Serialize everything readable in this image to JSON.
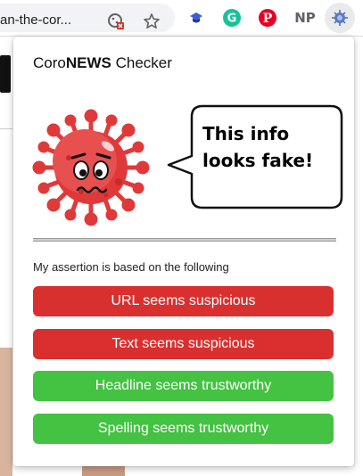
{
  "browser": {
    "url_fragment": "an-the-cor...",
    "extensions": [
      "pinwheel-extension-icon",
      "grammarly-icon",
      "pinterest-icon",
      "np-icon",
      "coronews-icon"
    ],
    "np_label": "NP"
  },
  "popup": {
    "title_prefix": "Coro",
    "title_bold": "NEWS",
    "title_suffix": " Checker",
    "verdict_line1": "This info",
    "verdict_line2": "looks fake!",
    "assertion_label": "My assertion is based on the following",
    "reasons": [
      {
        "label": "URL seems suspicious",
        "status": "suspicious"
      },
      {
        "label": "Text seems suspicious",
        "status": "suspicious"
      },
      {
        "label": "Headline seems trustworthy",
        "status": "trustworthy"
      },
      {
        "label": "Spelling seems trustworthy",
        "status": "trustworthy"
      }
    ]
  },
  "colors": {
    "suspicious": "#d9302f",
    "trustworthy": "#44c242",
    "virus": "#e0393a"
  }
}
